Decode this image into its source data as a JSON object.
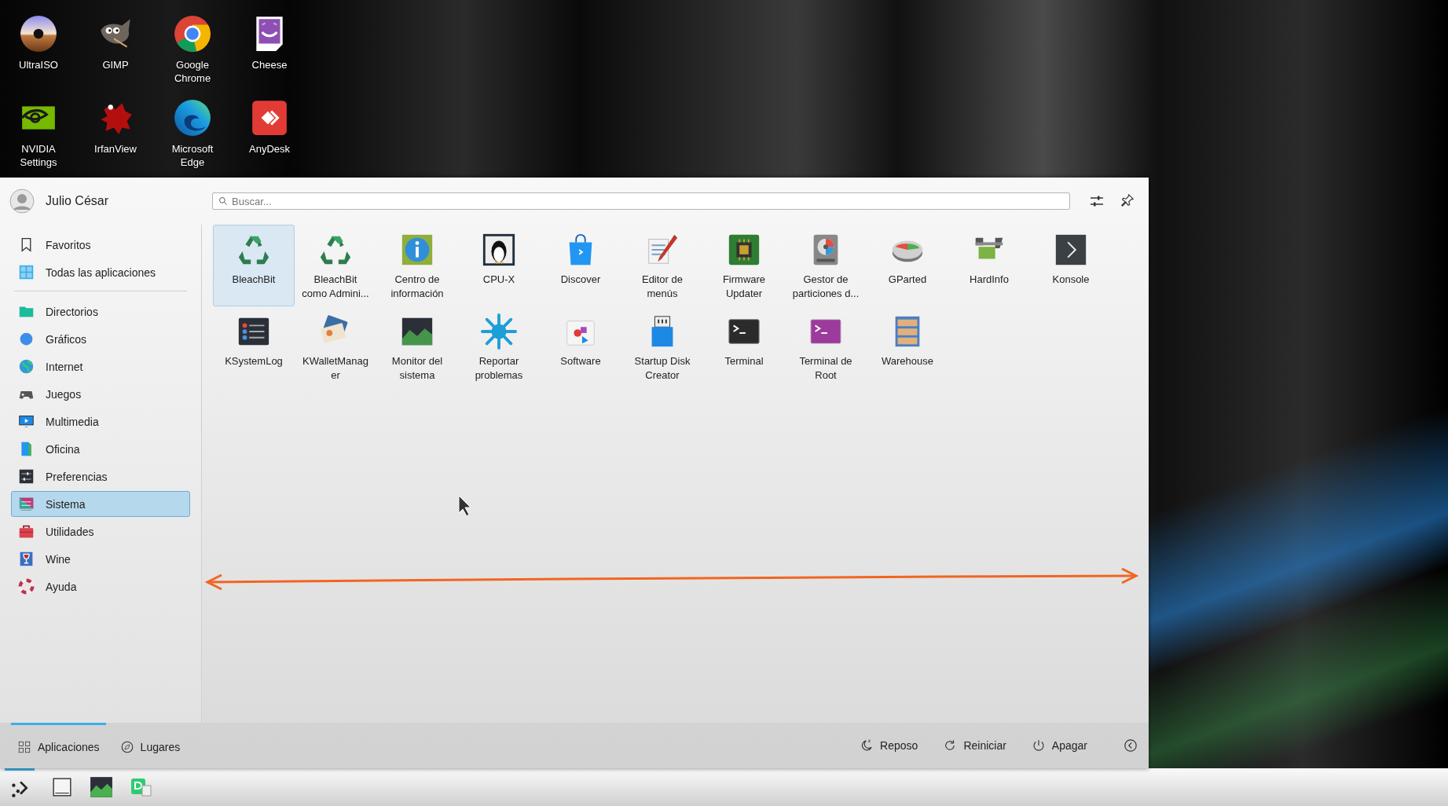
{
  "desktop": {
    "icons": [
      {
        "label": "UltraISO"
      },
      {
        "label": "GIMP"
      },
      {
        "label": "Google Chrome"
      },
      {
        "label": "Cheese"
      },
      {
        "label": "NVIDIA Settings"
      },
      {
        "label": "IrfanView"
      },
      {
        "label": "Microsoft Edge"
      },
      {
        "label": "AnyDesk"
      }
    ]
  },
  "menu": {
    "user": {
      "name": "Julio César"
    },
    "search": {
      "placeholder": "Buscar..."
    },
    "sidebar": {
      "pinned": [
        {
          "label": "Favoritos",
          "selected": false
        },
        {
          "label": "Todas las aplicaciones",
          "selected": false
        }
      ],
      "categories": [
        {
          "label": "Directorios",
          "selected": false
        },
        {
          "label": "Gráficos",
          "selected": false
        },
        {
          "label": "Internet",
          "selected": false
        },
        {
          "label": "Juegos",
          "selected": false
        },
        {
          "label": "Multimedia",
          "selected": false
        },
        {
          "label": "Oficina",
          "selected": false
        },
        {
          "label": "Preferencias",
          "selected": false
        },
        {
          "label": "Sistema",
          "selected": true
        },
        {
          "label": "Utilidades",
          "selected": false
        },
        {
          "label": "Wine",
          "selected": false
        },
        {
          "label": "Ayuda",
          "selected": false
        }
      ]
    },
    "apps": [
      {
        "label": "BleachBit",
        "selected": true
      },
      {
        "label": "BleachBit como Admini...",
        "selected": false
      },
      {
        "label": "Centro de información",
        "selected": false
      },
      {
        "label": "CPU-X",
        "selected": false
      },
      {
        "label": "Discover",
        "selected": false
      },
      {
        "label": "Editor de menús",
        "selected": false
      },
      {
        "label": "Firmware Updater",
        "selected": false
      },
      {
        "label": "Gestor de particiones d...",
        "selected": false
      },
      {
        "label": "GParted",
        "selected": false
      },
      {
        "label": "HardInfo",
        "selected": false
      },
      {
        "label": "Konsole",
        "selected": false
      },
      {
        "label": "KSystemLog",
        "selected": false
      },
      {
        "label": "KWalletManager",
        "selected": false
      },
      {
        "label": "Monitor del sistema",
        "selected": false
      },
      {
        "label": "Reportar problemas",
        "selected": false
      },
      {
        "label": "Software",
        "selected": false
      },
      {
        "label": "Startup Disk Creator",
        "selected": false
      },
      {
        "label": "Terminal",
        "selected": false
      },
      {
        "label": "Terminal de Root",
        "selected": false
      },
      {
        "label": "Warehouse",
        "selected": false
      }
    ],
    "footer": {
      "tabs": [
        {
          "label": "Aplicaciones",
          "selected": true
        },
        {
          "label": "Lugares",
          "selected": false
        }
      ],
      "actions": [
        {
          "label": "Reposo"
        },
        {
          "label": "Reiniciar"
        },
        {
          "label": "Apagar"
        }
      ]
    }
  },
  "taskbar": {
    "launcher": {
      "active": true
    }
  }
}
